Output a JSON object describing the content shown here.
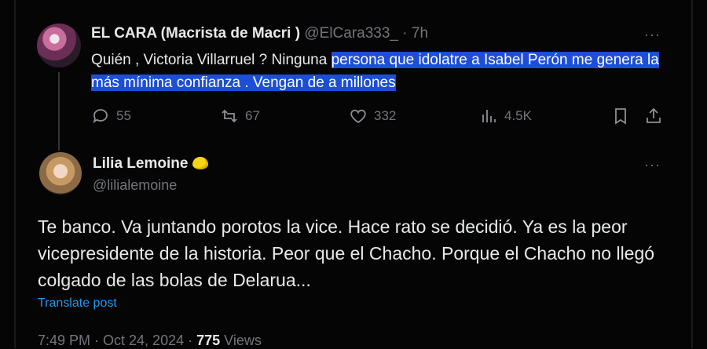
{
  "parent": {
    "display_name": "EL CARA (Macrista de Macri )",
    "handle": "@ElCara333_",
    "time": "· 7h",
    "more": "···",
    "text_before": "Quién , Victoria Villarruel ? Ninguna ",
    "text_highlighted": "persona que idolatre a Isabel Perón me genera la más mínima confianza . Vengan de a millones",
    "stats": {
      "replies": "55",
      "reposts": "67",
      "likes": "332",
      "views": "4.5K"
    }
  },
  "reply": {
    "display_name": "Lilia Lemoine",
    "emoji": "lemon-icon",
    "handle": "@lilialemoine",
    "more": "···",
    "text": "Te banco. Va juntando porotos la vice. Hace rato se decidió. Ya es la peor vicepresidente de la historia. Peor que el Chacho. Porque el Chacho no llegó colgado de las bolas de Delarua...",
    "translate": "Translate post",
    "timestamp": "7:49 PM · Oct 24, 2024 · ",
    "views_count": "775",
    "views_label": " Views"
  }
}
